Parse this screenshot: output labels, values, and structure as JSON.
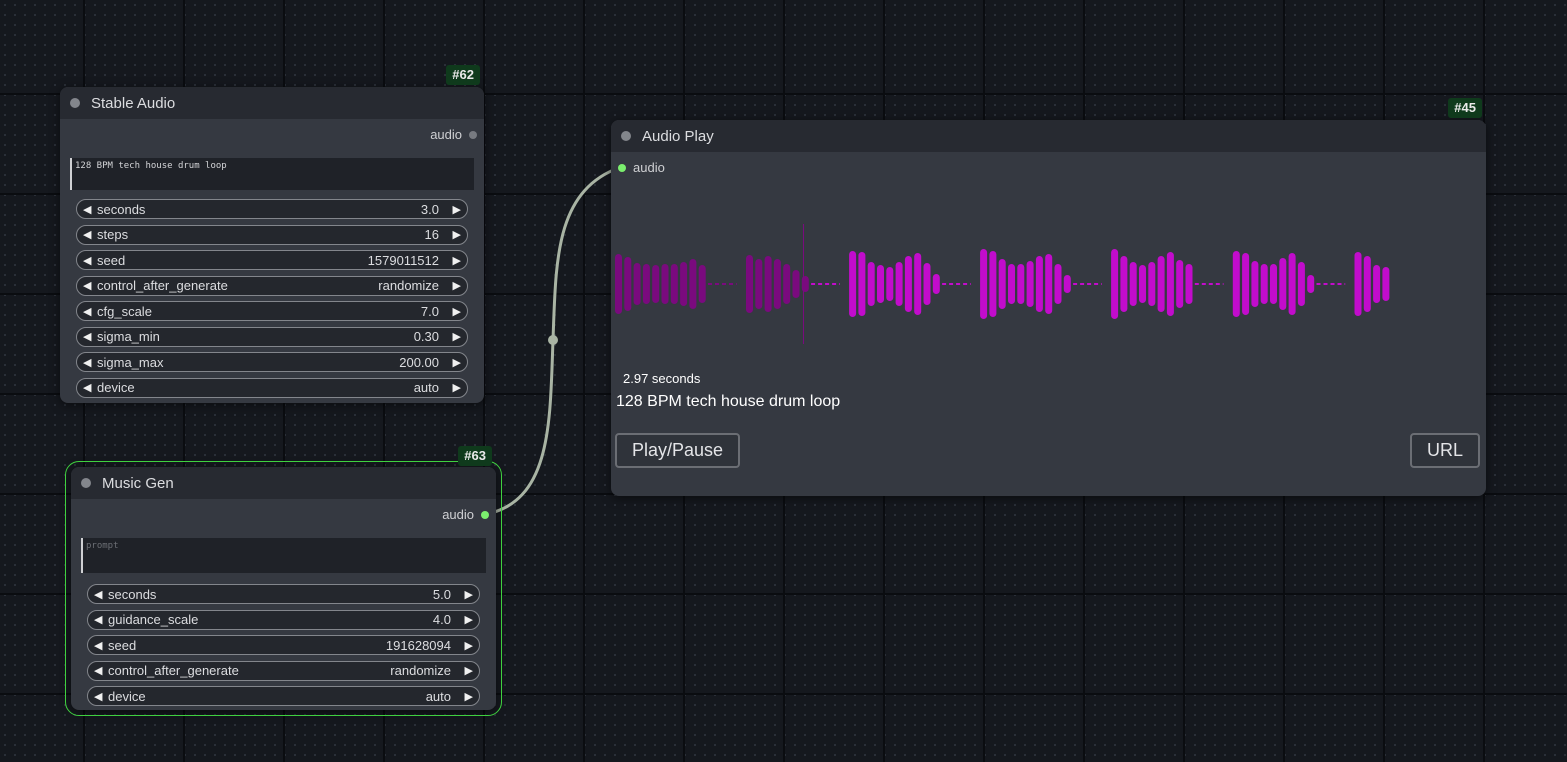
{
  "nodes": {
    "stable_audio": {
      "id": "#62",
      "title": "Stable Audio",
      "output_label": "audio",
      "prompt_text": "128 BPM tech house drum loop",
      "widgets": [
        {
          "name": "seconds",
          "value": "3.0"
        },
        {
          "name": "steps",
          "value": "16"
        },
        {
          "name": "seed",
          "value": "1579011512"
        },
        {
          "name": "control_after_generate",
          "value": "randomize"
        },
        {
          "name": "cfg_scale",
          "value": "7.0"
        },
        {
          "name": "sigma_min",
          "value": "0.30"
        },
        {
          "name": "sigma_max",
          "value": "200.00"
        },
        {
          "name": "device",
          "value": "auto"
        }
      ]
    },
    "music_gen": {
      "id": "#63",
      "title": "Music Gen",
      "output_label": "audio",
      "prompt_placeholder": "prompt",
      "widgets": [
        {
          "name": "seconds",
          "value": "5.0"
        },
        {
          "name": "guidance_scale",
          "value": "4.0"
        },
        {
          "name": "seed",
          "value": "191628094"
        },
        {
          "name": "control_after_generate",
          "value": "randomize"
        },
        {
          "name": "device",
          "value": "auto"
        }
      ]
    },
    "audio_play": {
      "id": "#45",
      "title": "Audio Play",
      "input_label": "audio",
      "duration_text": "2.97 seconds",
      "caption": "128 BPM tech house drum loop",
      "play_pause_label": "Play/Pause",
      "url_label": "URL",
      "waveform_played_fraction": 0.22,
      "waveform_played_color": "#7a0a7e",
      "waveform_unplayed_color": "#c20ccc"
    }
  },
  "icons": {
    "decrement": "◀",
    "increment": "▶"
  },
  "colors": {
    "connected_port": "#7bef6e",
    "link": "#a9b4a4",
    "selection_outline": "#3fd13f",
    "id_badge": "#0f3a1c"
  }
}
